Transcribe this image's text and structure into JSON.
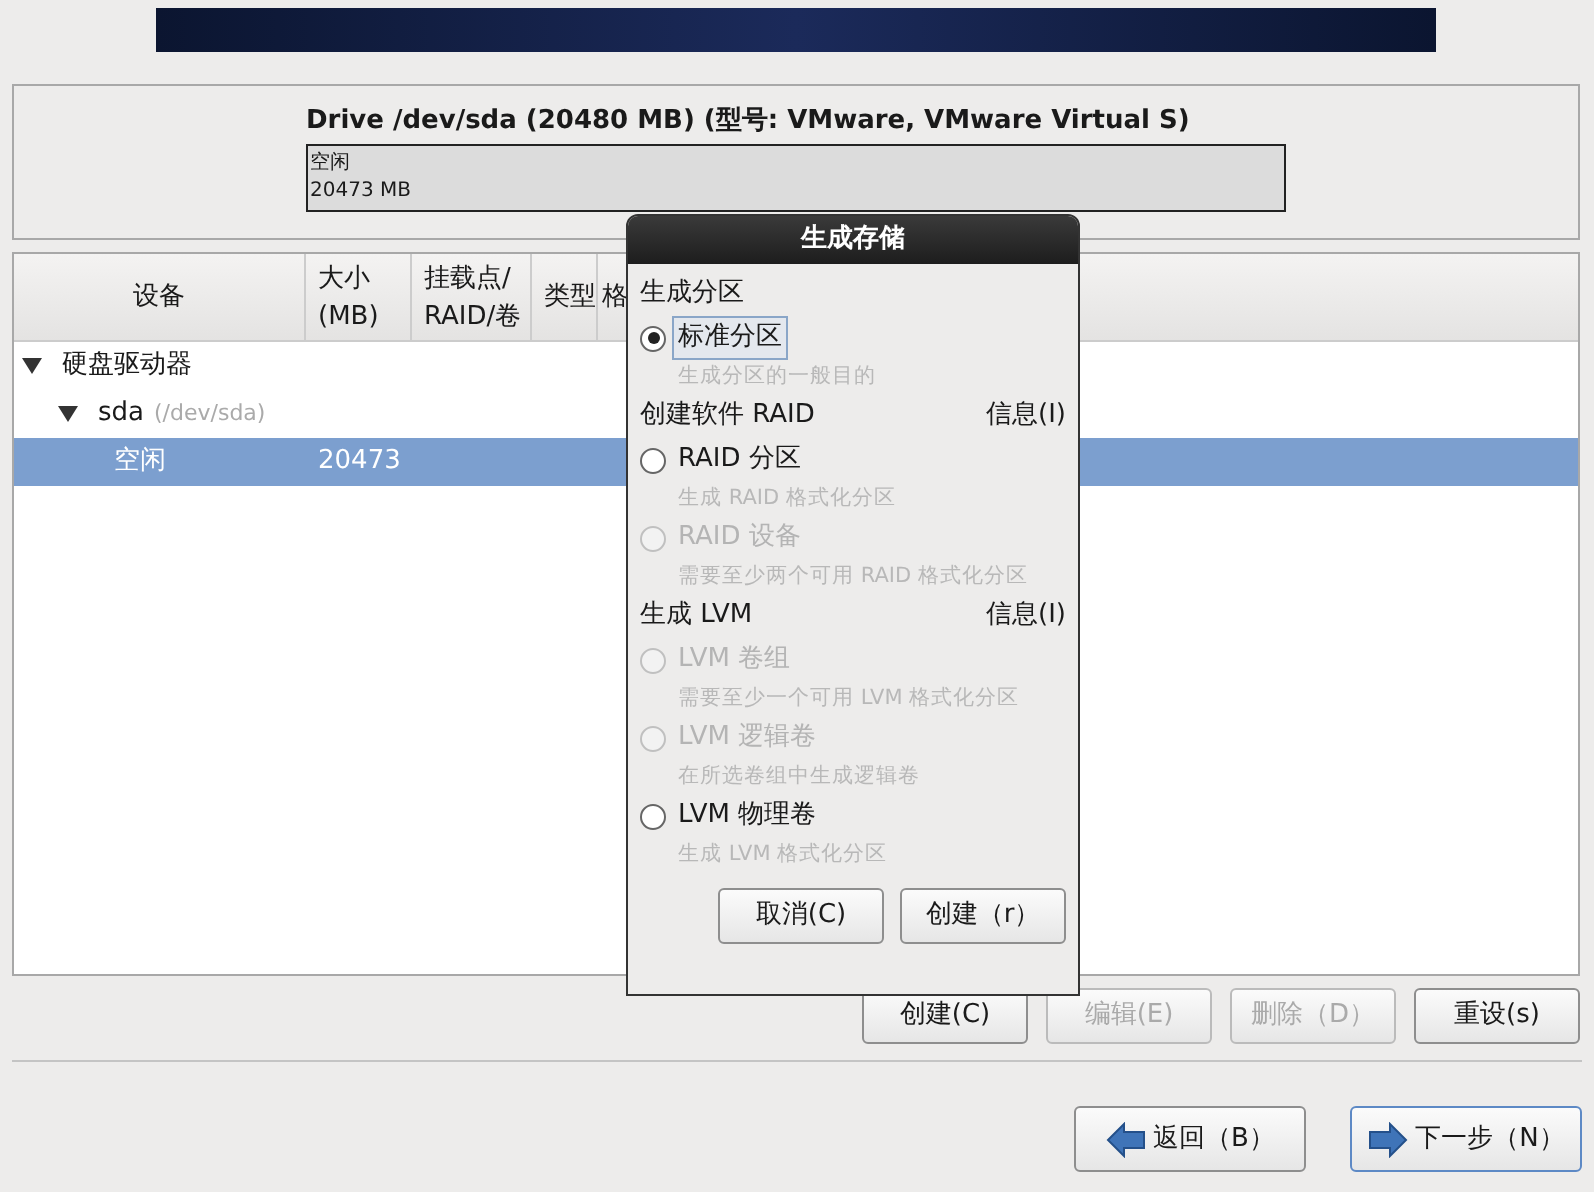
{
  "drive": {
    "title": "Drive /dev/sda (20480 MB) (型号: VMware, VMware Virtual S)",
    "segments": [
      {
        "label": "空闲",
        "size": "20473 MB"
      }
    ]
  },
  "table": {
    "columns": [
      {
        "lines": [
          "设备"
        ]
      },
      {
        "lines": [
          "大小",
          "(MB)"
        ]
      },
      {
        "lines": [
          "挂载点/",
          "RAID/卷"
        ]
      },
      {
        "lines": [
          "类型"
        ]
      },
      {
        "lines": [
          "格"
        ]
      }
    ],
    "rows": [
      {
        "device": "硬盘驱动器",
        "expanded": true,
        "selected": false,
        "children": [
          {
            "device": "sda",
            "path": "(/dev/sda)",
            "expanded": true,
            "selected": false,
            "children": [
              {
                "device": "空闲",
                "size": "20473",
                "selected": true
              }
            ]
          }
        ]
      }
    ]
  },
  "dialog": {
    "title": "生成存储",
    "sections": [
      {
        "heading": "生成分区",
        "options": [
          {
            "label": "标准分区",
            "description": "生成分区的一般目的",
            "selected": true,
            "disabled": false
          }
        ]
      },
      {
        "heading": "创建软件 RAID",
        "info": "信息(I)",
        "options": [
          {
            "label": "RAID 分区",
            "description": "生成 RAID 格式化分区",
            "selected": false,
            "disabled": false
          },
          {
            "label": "RAID 设备",
            "description": "需要至少两个可用 RAID 格式化分区",
            "selected": false,
            "disabled": true
          }
        ]
      },
      {
        "heading": "生成 LVM",
        "info": "信息(I)",
        "options": [
          {
            "label": "LVM 卷组",
            "description": "需要至少一个可用 LVM 格式化分区",
            "selected": false,
            "disabled": true
          },
          {
            "label": "LVM 逻辑卷",
            "description": "在所选卷组中生成逻辑卷",
            "selected": false,
            "disabled": true
          },
          {
            "label": "LVM 物理卷",
            "description": "生成 LVM 格式化分区",
            "selected": false,
            "disabled": false
          }
        ]
      }
    ],
    "buttons": [
      {
        "label": "取消(C)"
      },
      {
        "label": "创建（r）"
      }
    ]
  },
  "actions": [
    {
      "label": "创建(C)",
      "disabled": false
    },
    {
      "label": "编辑(E)",
      "disabled": true
    },
    {
      "label": "删除（D）",
      "disabled": true
    },
    {
      "label": "重设(s)",
      "disabled": false
    }
  ],
  "navigation": [
    {
      "label": "返回（B）",
      "kind": "back",
      "focused": false
    },
    {
      "label": "下一步（N）",
      "kind": "next",
      "focused": true
    }
  ]
}
